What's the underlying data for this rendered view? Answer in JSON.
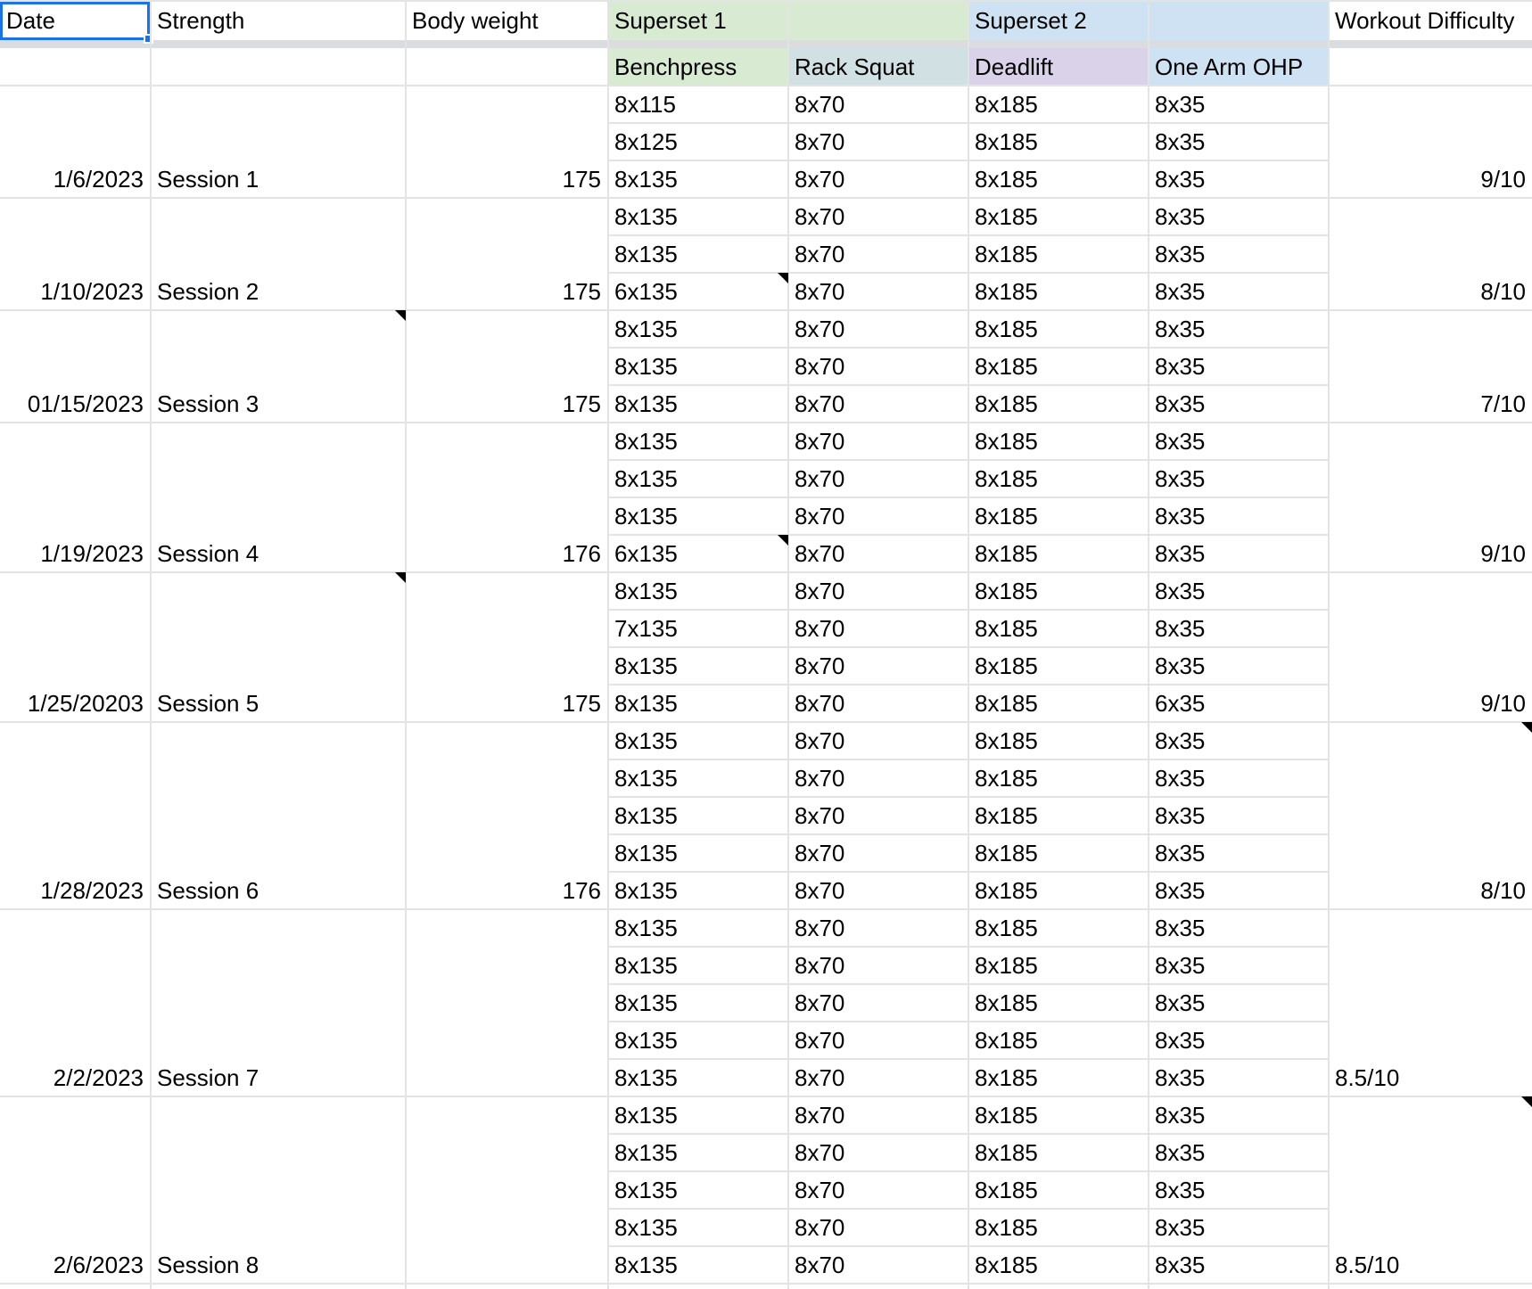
{
  "headers": {
    "date": "Date",
    "strength": "Strength",
    "body_weight": "Body weight",
    "superset1": "Superset 1",
    "superset2": "Superset 2",
    "difficulty": "Workout Difficulty"
  },
  "subheaders": {
    "benchpress": "Benchpress",
    "rack_squat": "Rack Squat",
    "deadlift": "Deadlift",
    "ohp": "One Arm OHP"
  },
  "colors": {
    "superset1": "#d9ead3",
    "rack_squat": "#d0e0e3",
    "superset2": "#cfe2f3",
    "deadlift": "#d9d2e9",
    "ohp": "#cfe2f3",
    "selection": "#1a73e8",
    "gridline": "#e2e3e3"
  },
  "sessions": [
    {
      "date": "1/6/2023",
      "name": "Session 1",
      "weight": "175",
      "difficulty": "9/10",
      "bench": [
        "8x115",
        "8x125",
        "8x135"
      ],
      "squat": [
        "8x70",
        "8x70",
        "8x70"
      ],
      "deadlift": [
        "8x185",
        "8x185",
        "8x185"
      ],
      "ohp": [
        "8x35",
        "8x35",
        "8x35"
      ]
    },
    {
      "date": "1/10/2023",
      "name": "Session 2",
      "weight": "175",
      "difficulty": "8/10",
      "bench": [
        "8x135",
        "8x135",
        "6x135"
      ],
      "squat": [
        "8x70",
        "8x70",
        "8x70"
      ],
      "deadlift": [
        "8x185",
        "8x185",
        "8x185"
      ],
      "ohp": [
        "8x35",
        "8x35",
        "8x35"
      ]
    },
    {
      "date": "01/15/2023",
      "name": "Session 3",
      "weight": "175",
      "difficulty": "7/10",
      "bench": [
        "8x135",
        "8x135",
        "8x135"
      ],
      "squat": [
        "8x70",
        "8x70",
        "8x70"
      ],
      "deadlift": [
        "8x185",
        "8x185",
        "8x185"
      ],
      "ohp": [
        "8x35",
        "8x35",
        "8x35"
      ]
    },
    {
      "date": "1/19/2023",
      "name": "Session 4",
      "weight": "176",
      "difficulty": "9/10",
      "bench": [
        "8x135",
        "8x135",
        "8x135",
        "6x135"
      ],
      "squat": [
        "8x70",
        "8x70",
        "8x70",
        "8x70"
      ],
      "deadlift": [
        "8x185",
        "8x185",
        "8x185",
        "8x185"
      ],
      "ohp": [
        "8x35",
        "8x35",
        "8x35",
        "8x35"
      ]
    },
    {
      "date": "1/25/20203",
      "name": "Session 5",
      "weight": "175",
      "difficulty": "9/10",
      "bench": [
        "8x135",
        "7x135",
        "8x135",
        "8x135"
      ],
      "squat": [
        "8x70",
        "8x70",
        "8x70",
        "8x70"
      ],
      "deadlift": [
        "8x185",
        "8x185",
        "8x185",
        "8x185"
      ],
      "ohp": [
        "8x35",
        "8x35",
        "8x35",
        "6x35"
      ]
    },
    {
      "date": "1/28/2023",
      "name": "Session 6",
      "weight": "176",
      "difficulty": "8/10",
      "bench": [
        "8x135",
        "8x135",
        "8x135",
        "8x135",
        "8x135"
      ],
      "squat": [
        "8x70",
        "8x70",
        "8x70",
        "8x70",
        "8x70"
      ],
      "deadlift": [
        "8x185",
        "8x185",
        "8x185",
        "8x185",
        "8x185"
      ],
      "ohp": [
        "8x35",
        "8x35",
        "8x35",
        "8x35",
        "8x35"
      ]
    },
    {
      "date": "2/2/2023",
      "name": "Session 7",
      "weight": "",
      "difficulty": "8.5/10",
      "bench": [
        "8x135",
        "8x135",
        "8x135",
        "8x135",
        "8x135"
      ],
      "squat": [
        "8x70",
        "8x70",
        "8x70",
        "8x70",
        "8x70"
      ],
      "deadlift": [
        "8x185",
        "8x185",
        "8x185",
        "8x185",
        "8x185"
      ],
      "ohp": [
        "8x35",
        "8x35",
        "8x35",
        "8x35",
        "8x35"
      ]
    },
    {
      "date": "2/6/2023",
      "name": "Session 8",
      "weight": "",
      "difficulty": "8.5/10",
      "bench": [
        "8x135",
        "8x135",
        "8x135",
        "8x135",
        "8x135"
      ],
      "squat": [
        "8x70",
        "8x70",
        "8x70",
        "8x70",
        "8x70"
      ],
      "deadlift": [
        "8x185",
        "8x185",
        "8x185",
        "8x185",
        "8x185"
      ],
      "ohp": [
        "8x35",
        "8x35",
        "8x35",
        "8x35",
        "8x35"
      ]
    }
  ]
}
